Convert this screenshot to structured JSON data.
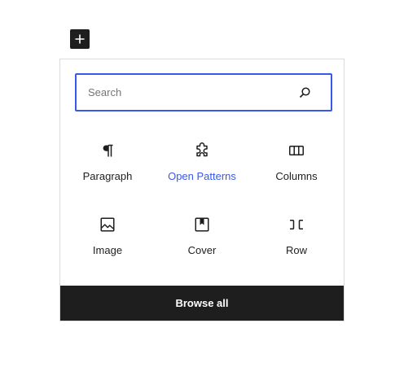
{
  "toggle": {
    "icon": "plus-icon"
  },
  "search": {
    "placeholder": "Search",
    "value": "",
    "icon": "search-icon"
  },
  "blocks": [
    {
      "label": "Paragraph",
      "icon": "paragraph-icon"
    },
    {
      "label": "Open Patterns",
      "icon": "puzzle-piece-icon",
      "highlighted": true
    },
    {
      "label": "Columns",
      "icon": "columns-icon"
    },
    {
      "label": "Image",
      "icon": "image-icon"
    },
    {
      "label": "Cover",
      "icon": "cover-icon"
    },
    {
      "label": "Row",
      "icon": "row-icon"
    }
  ],
  "footer": {
    "browse_all_label": "Browse all"
  },
  "colors": {
    "accent": "#3858e9",
    "dark": "#1e1e1e",
    "border": "#dcdcde"
  }
}
